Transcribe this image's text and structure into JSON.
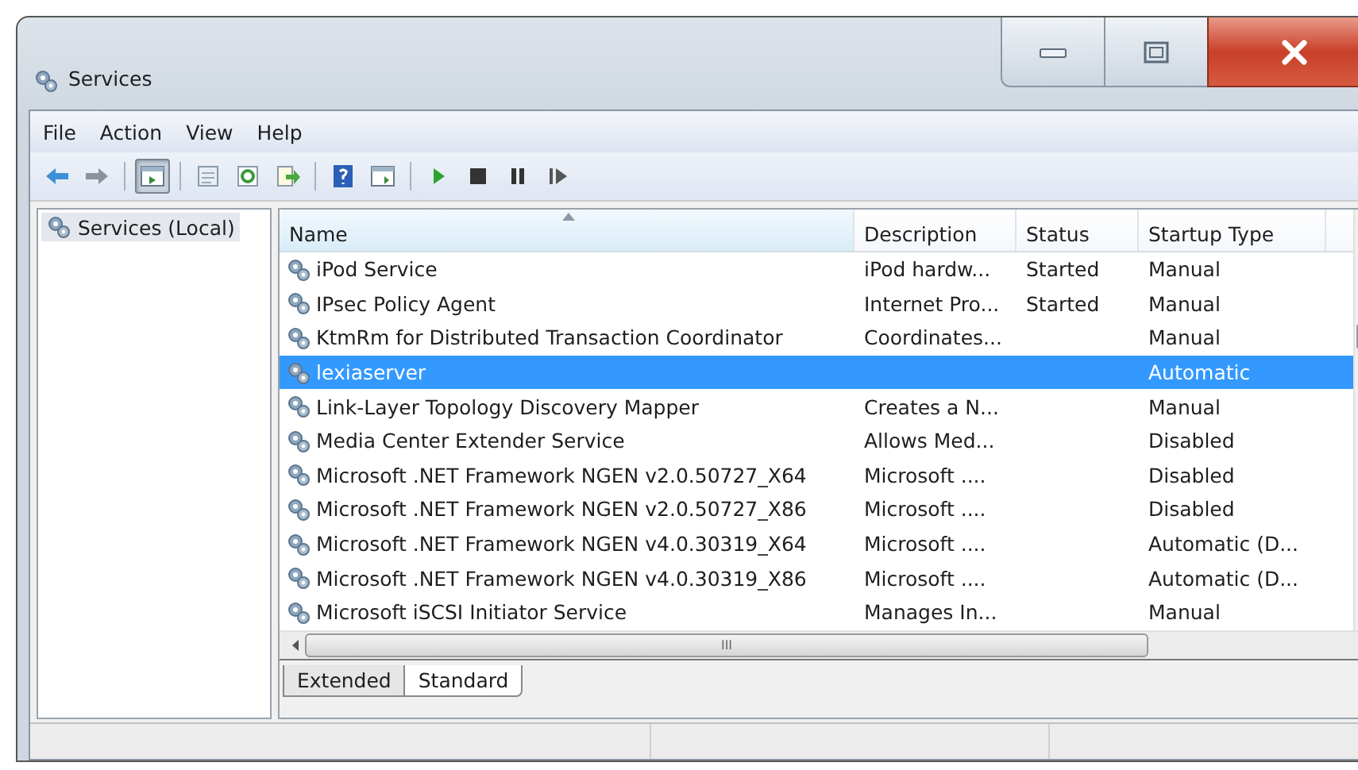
{
  "window": {
    "title": "Services"
  },
  "menu": [
    "File",
    "Action",
    "View",
    "Help"
  ],
  "toolbar": [
    [
      {
        "kind": "back",
        "pressed": false
      },
      {
        "kind": "forward",
        "pressed": false
      }
    ],
    [
      {
        "kind": "tree",
        "pressed": true
      }
    ],
    [
      {
        "kind": "properties",
        "pressed": false
      },
      {
        "kind": "refresh",
        "pressed": false
      },
      {
        "kind": "export",
        "pressed": false
      }
    ],
    [
      {
        "kind": "help",
        "pressed": false
      },
      {
        "kind": "console",
        "pressed": false
      }
    ],
    [
      {
        "kind": "play",
        "pressed": false
      },
      {
        "kind": "stop",
        "pressed": false
      },
      {
        "kind": "pause",
        "pressed": false
      },
      {
        "kind": "resume",
        "pressed": false
      }
    ]
  ],
  "sidebar": {
    "items": [
      {
        "label": "Services (Local)",
        "selected": true
      }
    ]
  },
  "table": {
    "columns": [
      "Name",
      "Description",
      "Status",
      "Startup Type"
    ],
    "rows": [
      {
        "name": "iPod Service",
        "description": "iPod hardw...",
        "status": "Started",
        "startup": "Manual",
        "selected": false
      },
      {
        "name": "IPsec Policy Agent",
        "description": "Internet Pro...",
        "status": "Started",
        "startup": "Manual",
        "selected": false
      },
      {
        "name": "KtmRm for Distributed Transaction Coordinator",
        "description": "Coordinates...",
        "status": "",
        "startup": "Manual",
        "selected": false
      },
      {
        "name": "lexiaserver",
        "description": "",
        "status": "",
        "startup": "Automatic",
        "selected": true
      },
      {
        "name": "Link-Layer Topology Discovery Mapper",
        "description": "Creates a N...",
        "status": "",
        "startup": "Manual",
        "selected": false
      },
      {
        "name": "Media Center Extender Service",
        "description": "Allows Med...",
        "status": "",
        "startup": "Disabled",
        "selected": false
      },
      {
        "name": "Microsoft .NET Framework NGEN v2.0.50727_X64",
        "description": "Microsoft ....",
        "status": "",
        "startup": "Disabled",
        "selected": false
      },
      {
        "name": "Microsoft .NET Framework NGEN v2.0.50727_X86",
        "description": "Microsoft ....",
        "status": "",
        "startup": "Disabled",
        "selected": false
      },
      {
        "name": "Microsoft .NET Framework NGEN v4.0.30319_X64",
        "description": "Microsoft ....",
        "status": "",
        "startup": "Automatic (D...",
        "selected": false
      },
      {
        "name": "Microsoft .NET Framework NGEN v4.0.30319_X86",
        "description": "Microsoft ....",
        "status": "",
        "startup": "Automatic (D...",
        "selected": false
      },
      {
        "name": "Microsoft iSCSI Initiator Service",
        "description": "Manages In...",
        "status": "",
        "startup": "Manual",
        "selected": false
      }
    ]
  },
  "hscroll_glyph": "III",
  "tabs": [
    {
      "label": "Extended",
      "selected": false
    },
    {
      "label": "Standard",
      "selected": true
    }
  ]
}
